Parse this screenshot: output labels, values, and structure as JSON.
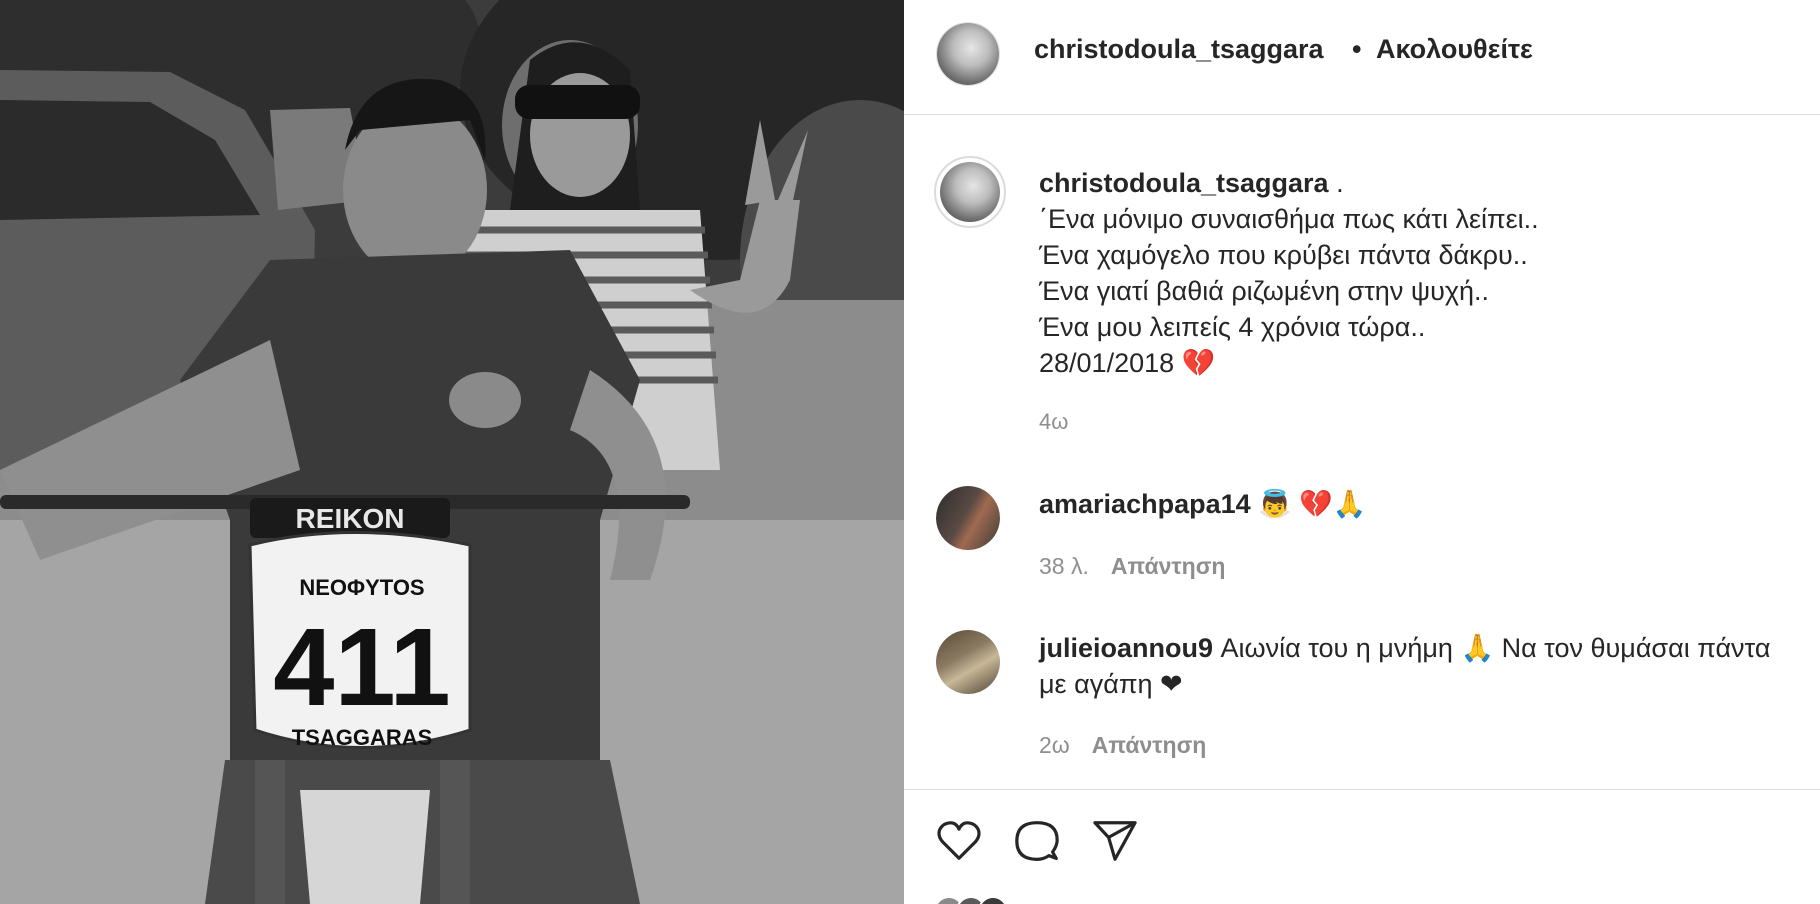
{
  "post": {
    "username": "christodoula_tsaggara",
    "follow_label": "Ακολουθείτε",
    "separator": "•",
    "caption_username": "christodoula_tsaggara",
    "caption_suffix": " .",
    "caption_lines": [
      "΄Ενα μόνιμο συναισθήμα πως κάτι λείπει..",
      "Ένα χαμόγελο που κρύβει πάντα δάκρυ..",
      "Ένα γιατί βαθιά ριζωμένη στην ψυχή..",
      "Ένα μου λειπείς 4 χρόνια τώρα..",
      "28/01/2018 💔"
    ],
    "time_ago": "4ω"
  },
  "photo": {
    "bike_brand": "REIKON",
    "plate_name": "NEOΦYTOS",
    "plate_number": "411",
    "plate_surname": "TSAGGARAS"
  },
  "comments": [
    {
      "username": "amariachpapa14",
      "text": " 👼 💔🙏",
      "time": "38 λ.",
      "reply_label": "Απάντηση"
    },
    {
      "username": "julieioannou9",
      "text_line1": " Αιωνία του η μνήμη 🙏 Να τον θυμάσαι πάντα",
      "text_line2": "με αγάπη ❤",
      "time": "2ω",
      "reply_label": "Απάντηση"
    }
  ],
  "actions": {
    "like_icon": "heart-icon",
    "comment_icon": "comment-icon",
    "share_icon": "send-icon"
  },
  "colors": {
    "text": "#262626",
    "muted": "#8e8e8e",
    "border": "#dbdbdb"
  }
}
